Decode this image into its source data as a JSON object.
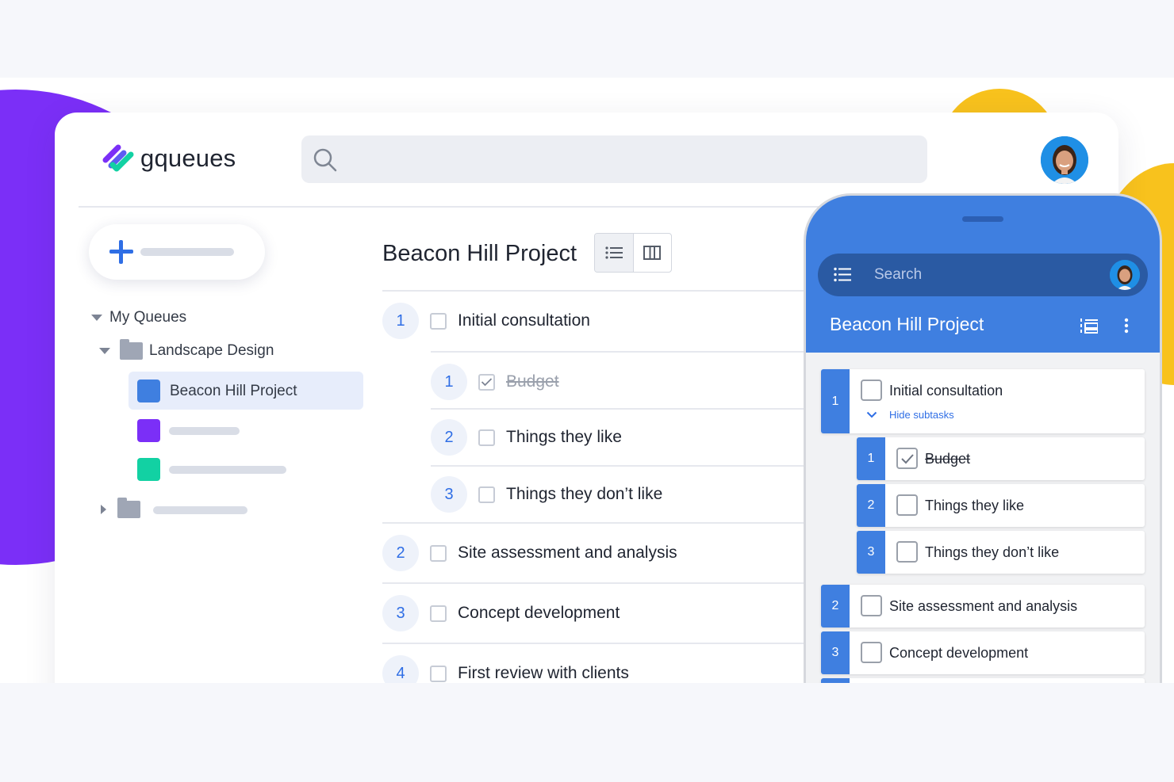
{
  "app": {
    "name": "gqueues"
  },
  "colors": {
    "accent": "#2f6ee5",
    "purple": "#7b2ff7",
    "yellow": "#f8c21d",
    "green": "#12d1a3",
    "phone_header": "#3f7fe0"
  },
  "sidebar": {
    "my_queues": "My Queues",
    "folder": "Landscape Design",
    "selected_queue": "Beacon Hill Project"
  },
  "project": {
    "title": "Beacon Hill Project",
    "tasks": [
      {
        "num": "1",
        "label": "Initial consultation",
        "checked": false
      },
      {
        "num": "1",
        "label": "Budget",
        "checked": true
      },
      {
        "num": "2",
        "label": "Things they like",
        "checked": false
      },
      {
        "num": "3",
        "label": "Things they don’t like",
        "checked": false
      },
      {
        "num": "2",
        "label": "Site assessment and analysis",
        "checked": false
      },
      {
        "num": "3",
        "label": "Concept development",
        "checked": false
      },
      {
        "num": "4",
        "label": "First review with clients",
        "checked": false
      }
    ]
  },
  "phone": {
    "search_placeholder": "Search",
    "title": "Beacon Hill Project",
    "hide_subtasks": "Hide subtasks",
    "tasks": [
      {
        "num": "1",
        "label": "Initial consultation"
      },
      {
        "num": "1",
        "label": "Budget"
      },
      {
        "num": "2",
        "label": "Things they like"
      },
      {
        "num": "3",
        "label": "Things they don’t like"
      },
      {
        "num": "2",
        "label": "Site assessment and analysis"
      },
      {
        "num": "3",
        "label": "Concept development"
      }
    ]
  }
}
